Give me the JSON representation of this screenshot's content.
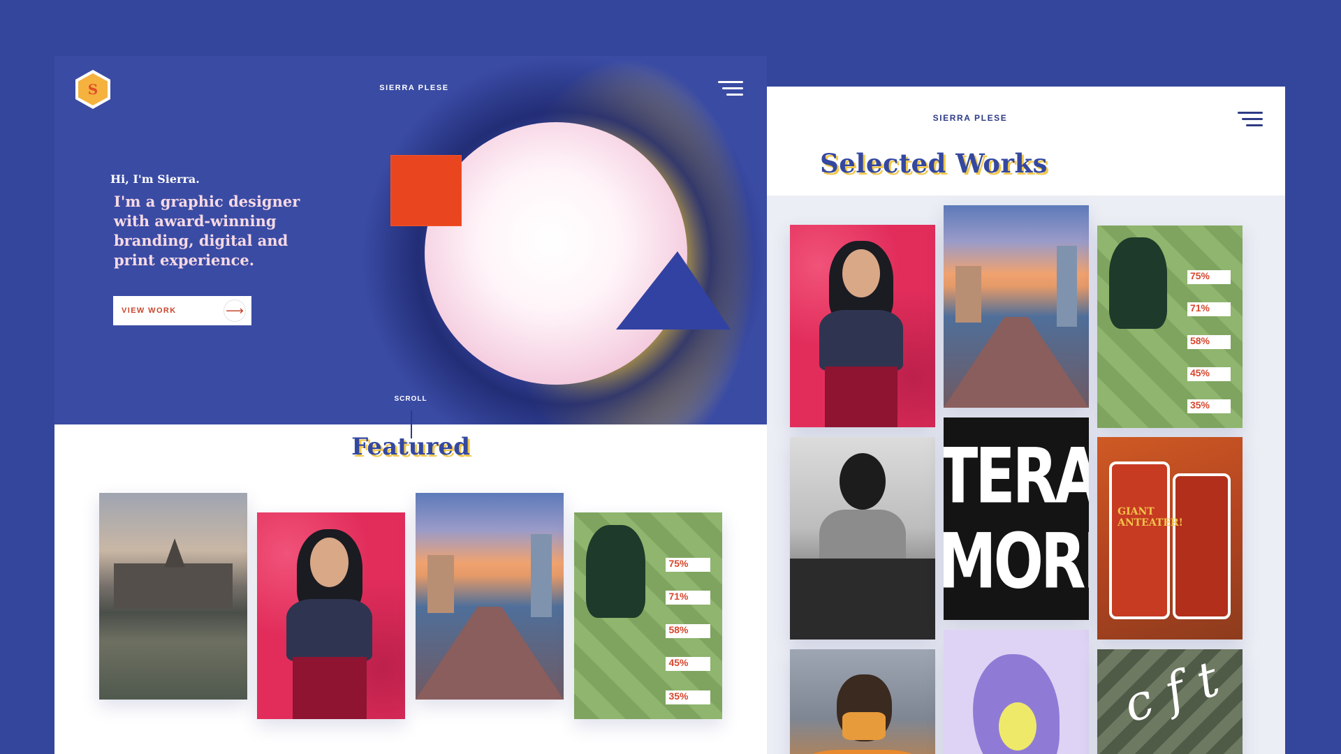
{
  "home": {
    "brand": "SIERRA PLESE",
    "logo_letter": "S",
    "greeting": "Hi, I'm Sierra.",
    "tagline": "I'm a graphic designer with award-winning branding, digital and print experience.",
    "cta_label": "VIEW WORK",
    "cta_arrow": "⟶",
    "scroll_label": "SCROLL",
    "featured_title": "Featured"
  },
  "works_page": {
    "brand": "SIERRA PLESE",
    "title": "Selected Works"
  },
  "soccer_stats": [
    "75%",
    "71%",
    "58%",
    "45%",
    "35%"
  ],
  "poster_text": [
    "TERANS",
    "MORIAL"
  ],
  "zoo_text": "GIANT ANTEATER!",
  "map_text": "c f t",
  "icons": [
    "logo-hex-icon",
    "menu-icon",
    "arrow-right-icon"
  ],
  "colors": {
    "background": "#34469b",
    "hero_blue": "#3a4ba4",
    "accent_yellow": "#e9c13c",
    "accent_red": "#e9461f",
    "title_blue": "#3448a0"
  }
}
